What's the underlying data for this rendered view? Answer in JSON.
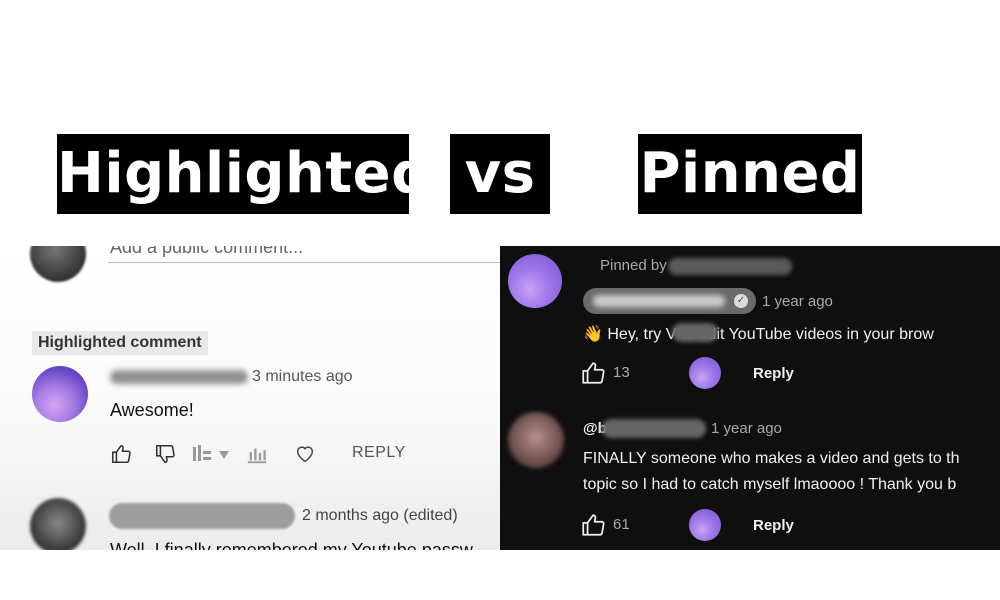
{
  "titles": {
    "left": "Highlighted",
    "middle": "vs",
    "right": "Pinned"
  },
  "highlighted_panel": {
    "add_comment_placeholder": "Add a public comment...",
    "badge": "Highlighted comment",
    "comment": {
      "author": "VEED CREATORS",
      "time": "3 minutes ago",
      "text": "Awesome!",
      "reply_label": "REPLY"
    },
    "next_comment": {
      "time": "2 months ago (edited)",
      "text": "Well, I finally remembered my Youtube passw"
    }
  },
  "pinned_panel": {
    "pinned_label": "Pinned by",
    "comment1": {
      "time": "1 year ago",
      "text": "👋 Hey, try V       to edit YouTube videos in your brow",
      "likes": "13",
      "reply_label": "Reply"
    },
    "comment2": {
      "author_prefix": "@b",
      "time": "1 year ago",
      "text_line1": "FINALLY someone who makes a video and gets to th",
      "text_line2": "topic so I had to catch myself lmaoooo ! Thank you b",
      "likes": "61",
      "reply_label": "Reply"
    }
  },
  "colors": {
    "title_bg": "#000000",
    "title_fg": "#ffffff",
    "dark_bg": "#0f0f0f",
    "avatar_purple": "#9b74e8"
  }
}
